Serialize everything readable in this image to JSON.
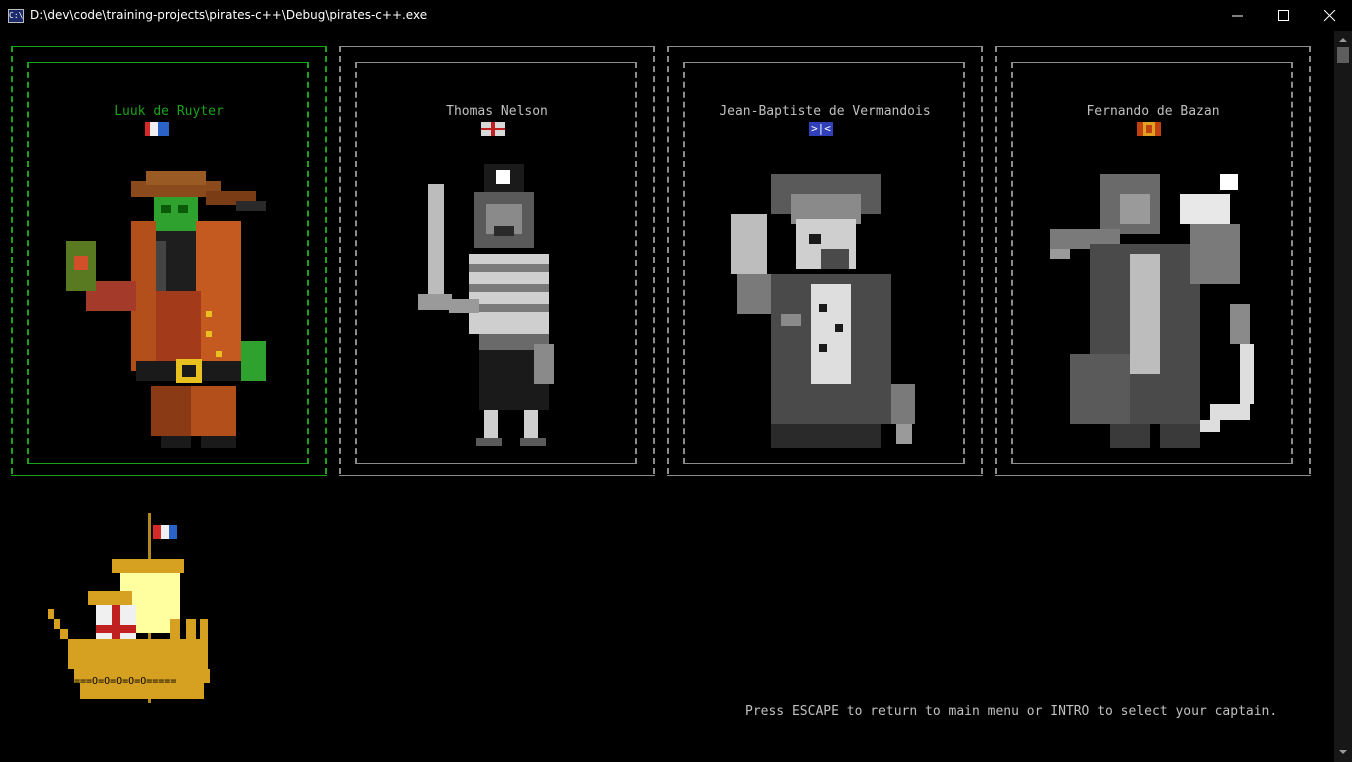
{
  "window": {
    "title": "D:\\dev\\code\\training-projects\\pirates-c++\\Debug\\pirates-c++.exe",
    "icon": "console-icon",
    "icon_text": "C:\\",
    "controls": [
      "minimize-icon",
      "maximize-icon",
      "close-icon"
    ]
  },
  "captains": [
    {
      "name": "Luuk de Ruyter",
      "flag": "netherlands-flag",
      "selected": true
    },
    {
      "name": "Thomas Nelson",
      "flag": "england-flag",
      "selected": false
    },
    {
      "name": "Jean-Baptiste de Vermandois",
      "flag": "france-flag",
      "flag_text": ">|<",
      "selected": false
    },
    {
      "name": "Fernando de Bazan",
      "flag": "spain-flag",
      "selected": false
    }
  ],
  "ship": {
    "flag": "netherlands-flag",
    "deck": "===O=O=O=O=O====="
  },
  "footer": {
    "instruction": "Press ESCAPE to return to main menu or INTRO to select your captain."
  },
  "colors": {
    "background": "#000000",
    "selected": "#1aa31a",
    "frame": "#8c8c8c",
    "text": "#c0c0c0"
  }
}
